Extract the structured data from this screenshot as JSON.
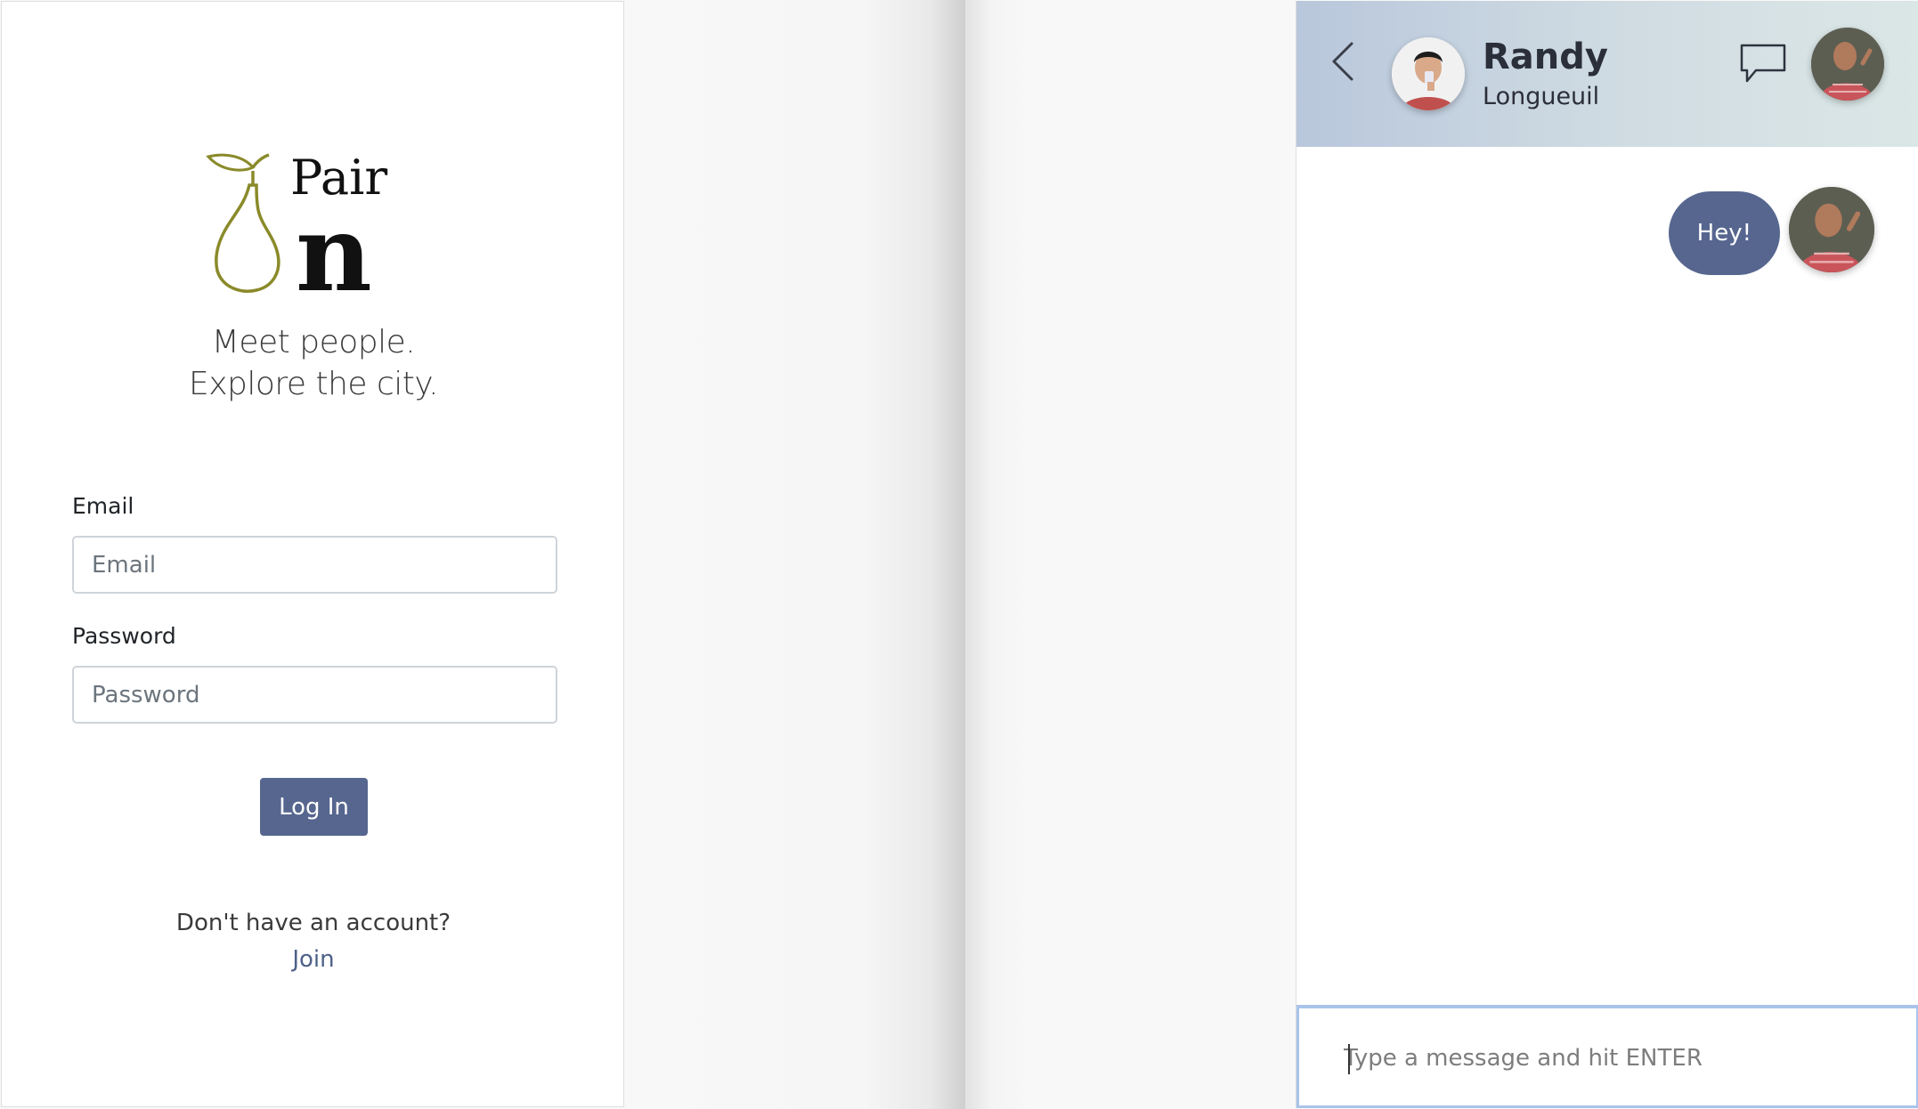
{
  "login": {
    "logo_text_top": "Pair",
    "logo_text_bottom": "n",
    "tagline_line1": "Meet people.",
    "tagline_line2": "Explore the city.",
    "email_label": "Email",
    "email_placeholder": "Email",
    "password_label": "Password",
    "password_placeholder": "Password",
    "login_button": "Log In",
    "signup_prompt": "Don't have an account?",
    "join_link": "Join"
  },
  "chat": {
    "contact_name": "Randy",
    "contact_location": "Longueuil",
    "messages": [
      {
        "text": "Hey!",
        "from": "me"
      }
    ],
    "composer_placeholder": "Type a message and hit ENTER"
  },
  "colors": {
    "accent": "#56668f",
    "link": "#4e6189",
    "logo_pear": "#8a8a2a",
    "header_gradient_start": "#b9c7dc",
    "header_gradient_end": "#dbe7e6"
  },
  "icons": [
    "pear-logo-icon",
    "back-chevron-icon",
    "chat-bubble-icon"
  ]
}
